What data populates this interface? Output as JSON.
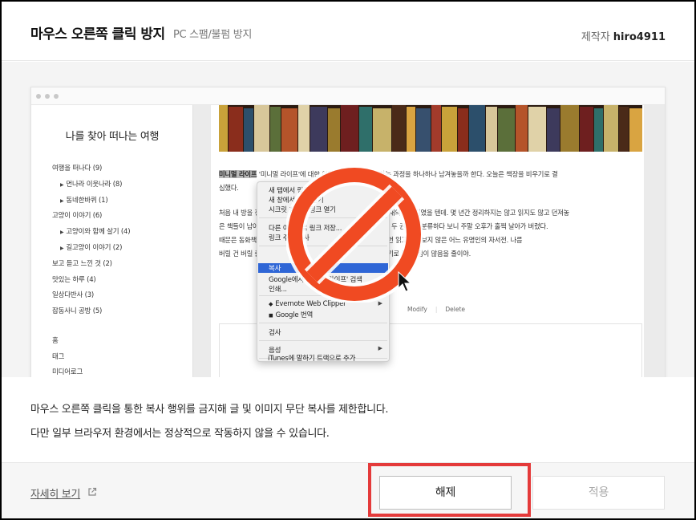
{
  "header": {
    "title": "마우스 오른쪽 클릭 방지",
    "subtitle": "PC 스팸/불펌 방지",
    "maker_label": "제작자",
    "maker_name": "hiro4911"
  },
  "preview": {
    "blog_title": "나를 찾아 떠나는 여행",
    "categories": [
      {
        "label": "여행을 떠나다 (9)",
        "sub": false
      },
      {
        "label": "먼나라 이웃나라 (8)",
        "sub": true
      },
      {
        "label": "동네한바퀴 (1)",
        "sub": true
      },
      {
        "label": "고양이 이야기 (6)",
        "sub": false
      },
      {
        "label": "고양이와 함께 살기 (4)",
        "sub": true
      },
      {
        "label": "길고양이 이야기 (2)",
        "sub": true
      },
      {
        "label": "보고 듣고 느낀 것 (2)",
        "sub": false
      },
      {
        "label": "맛있는 하루 (4)",
        "sub": false
      },
      {
        "label": "일상다반사 (3)",
        "sub": false
      },
      {
        "label": "잡동사니 공방 (5)",
        "sub": false
      }
    ],
    "nav_links": [
      "홈",
      "태그",
      "미디어로그"
    ],
    "post_lines": [
      {
        "highlight": "미니멀 라이프",
        "text": " '미니멀 라이프'에 대한 이야기를 하고자 청소하는 과정을 하나하나 남겨놓을까 한다. 오늘은 책장을 비우기로 결"
      },
      {
        "highlight": "",
        "text": "심했다."
      },
      {
        "highlight": "",
        "text": "처음 내 방을 정리할 때 '미니멀 라이프'를 실천하는 사람들의 서재의 이미지였을 텐데. 몇 년간 정리하지는 않고 읽지도 않고 던져놓"
      },
      {
        "highlight": "",
        "text": "은 책들이 남아 있었다. 이 책들을 정리하는 기준으로 책을 한 권 두 권 꺼내 분류하다 보니 주말 오후가 훌쩍 날아가 버렸다."
      },
      {
        "highlight": "",
        "text": "때문은 동화책부터 대학교 전공 서적, 여름방학 숙제 때문에 한 번 읽고 펼쳐보지 않은 어느 유명인의 자서전. 나름"
      },
      {
        "highlight": "",
        "text": "버릴 건 버릴 줄 알아야 한다는 생각에 책장의 절반 이상을 비우기로 했다. 짐이 많음을 줄이야."
      }
    ],
    "post_actions": [
      "Modify",
      "Delete"
    ],
    "context_menu": {
      "group1": [
        "새 탭에서 링크 열기",
        "새 창에서 링크 열기",
        "시크릿 창에서 링크 열기"
      ],
      "group2": [
        "다른 이름으로 링크 저장...",
        "링크 주소 복사"
      ],
      "group3_selected": "복사",
      "group3": [
        "Google에서 '미니멀 라이프' 검색",
        "인쇄..."
      ],
      "group4": [
        "Evernote Web Clipper",
        "Google 번역"
      ],
      "group5": [
        "검사"
      ],
      "group6": [
        "음성"
      ],
      "group7": [
        "iTunes에 말하기 트랙으로 추가"
      ]
    }
  },
  "message": {
    "line1": "마우스 오른쪽 클릭을 통한 복사 행위를 금지해 글 및 이미지 무단 복사를 제한합니다.",
    "line2": "다만 일부 브라우저 환경에서는 정상적으로 작동하지 않을 수 있습니다."
  },
  "footer": {
    "detail_link": "자세히 보기",
    "release_button": "해제",
    "apply_button": "적용"
  },
  "colors": {
    "forbid_red": "#f04a22",
    "highlight_frame": "#e43a3a",
    "menu_selection": "#2f66d6"
  }
}
